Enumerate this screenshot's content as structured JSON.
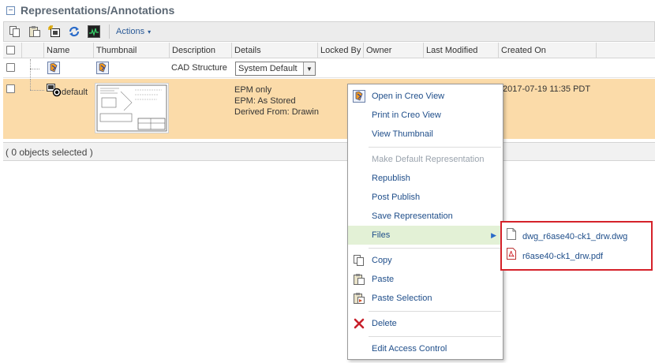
{
  "section": {
    "title": "Representations/Annotations",
    "collapse_symbol": "−"
  },
  "toolbar": {
    "icons": [
      "copy-icon",
      "paste-icon",
      "new-representation-icon",
      "refresh-icon",
      "monitor-icon"
    ],
    "actions_label": "Actions",
    "actions_caret": "▾"
  },
  "table": {
    "columns": [
      "Name",
      "Thumbnail",
      "Description",
      "Details",
      "Locked By",
      "Owner",
      "Last Modified",
      "Created On"
    ],
    "rows": [
      {
        "description": "CAD Structure",
        "details_select": "System Default",
        "select_arrow": "▼"
      },
      {
        "name": "default",
        "details": [
          "EPM only",
          "EPM: As Stored",
          "Derived From: Drawin"
        ],
        "created_on": "2017-07-19 11:35 PDT"
      }
    ]
  },
  "footer": {
    "selection_text": "( 0 objects selected )"
  },
  "context_menu": {
    "items": [
      {
        "label": "Open in Creo View",
        "icon": "creo-view-icon"
      },
      {
        "label": "Print in Creo View"
      },
      {
        "label": "View Thumbnail"
      },
      {
        "label": "Make Default Representation",
        "disabled": true
      },
      {
        "label": "Republish"
      },
      {
        "label": "Post Publish"
      },
      {
        "label": "Save Representation"
      },
      {
        "label": "Files",
        "has_submenu": true,
        "submenu_arrow": "▶"
      },
      {
        "label": "Copy",
        "icon": "copy-icon"
      },
      {
        "label": "Paste",
        "icon": "paste-icon"
      },
      {
        "label": "Paste Selection",
        "icon": "paste-selection-icon"
      },
      {
        "label": "Delete",
        "icon": "delete-icon"
      },
      {
        "label": "Edit Access Control"
      }
    ]
  },
  "files_submenu": {
    "items": [
      {
        "label": "dwg_r6ase40-ck1_drw.dwg",
        "icon": "document-icon"
      },
      {
        "label": "r6ase40-ck1_drw.pdf",
        "icon": "pdf-icon"
      }
    ]
  },
  "colors": {
    "selected_row": "#fbdba9",
    "highlight_item": "#e3f1d6",
    "submenu_border": "#d5222a",
    "link": "#1f4e8a"
  }
}
